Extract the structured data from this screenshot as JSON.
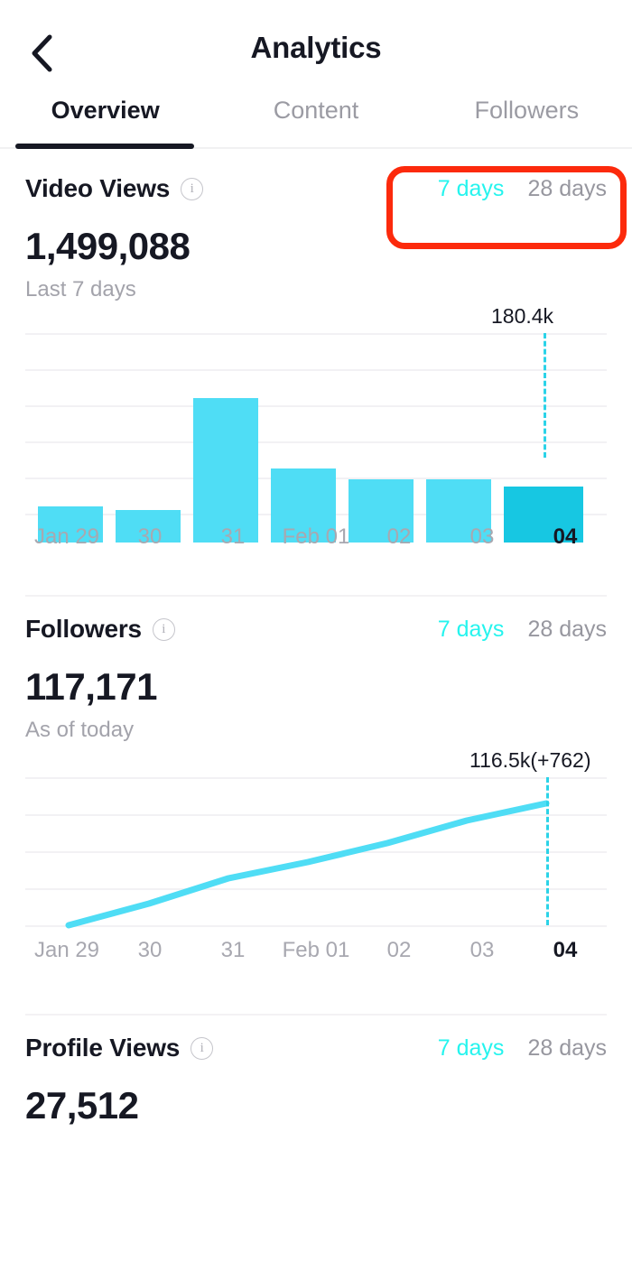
{
  "header": {
    "title": "Analytics",
    "back_icon": "chevron-left-icon"
  },
  "tabs": [
    {
      "label": "Overview",
      "active": true
    },
    {
      "label": "Content",
      "active": false
    },
    {
      "label": "Followers",
      "active": false
    }
  ],
  "range_options": {
    "short": "7 days",
    "long": "28 days",
    "selected": "7 days"
  },
  "info_icon_glyph": "i",
  "sections": [
    {
      "id": "video-views",
      "title": "Video Views",
      "value": "1,499,088",
      "subtitle": "Last 7 days"
    },
    {
      "id": "followers",
      "title": "Followers",
      "value": "117,171",
      "subtitle": "As of today"
    },
    {
      "id": "profile-views",
      "title": "Profile Views",
      "value": "27,512",
      "subtitle": ""
    }
  ],
  "colors": {
    "accent": "#25F4EE",
    "bar": "#4FDDF5",
    "bar_highlight": "#17C7E2",
    "line": "#4FDDF5",
    "highlight_box": "#FC2A0C",
    "text_primary": "#161823",
    "text_muted": "#a3a3ab",
    "gridline": "#f2f1f4"
  },
  "annotation": {
    "type": "highlight-box",
    "target": "video-views-range-toggle"
  },
  "chart_data": [
    {
      "type": "bar",
      "id": "video-views-chart",
      "title": "Video Views",
      "categories": [
        "Jan 29",
        "30",
        "31",
        "Feb 01",
        "02",
        "03",
        "04"
      ],
      "values": [
        52000,
        47000,
        209000,
        107000,
        92000,
        92000,
        180400
      ],
      "value_labels": [
        "",
        "",
        "",
        "",
        "",
        "",
        "180.4k"
      ],
      "annotation": "180.4k",
      "annotation_index": 6,
      "highlight_index": 6,
      "ylim": [
        0,
        261000
      ],
      "gridlines": 5,
      "xlabel": "",
      "ylabel": "",
      "legend": "none"
    },
    {
      "type": "line",
      "id": "followers-chart",
      "title": "Followers",
      "categories": [
        "Jan 29",
        "30",
        "31",
        "Feb 01",
        "02",
        "03",
        "04"
      ],
      "x": [
        0,
        1,
        2,
        3,
        4,
        5,
        6
      ],
      "values": [
        112900,
        113550,
        114300,
        114900,
        115400,
        115950,
        116500
      ],
      "annotation": "116.5k(+762)",
      "annotation_index": 6,
      "ylim": [
        112900,
        117550
      ],
      "gridlines": 5,
      "xlabel": "",
      "ylabel": "",
      "legend": "none"
    }
  ]
}
